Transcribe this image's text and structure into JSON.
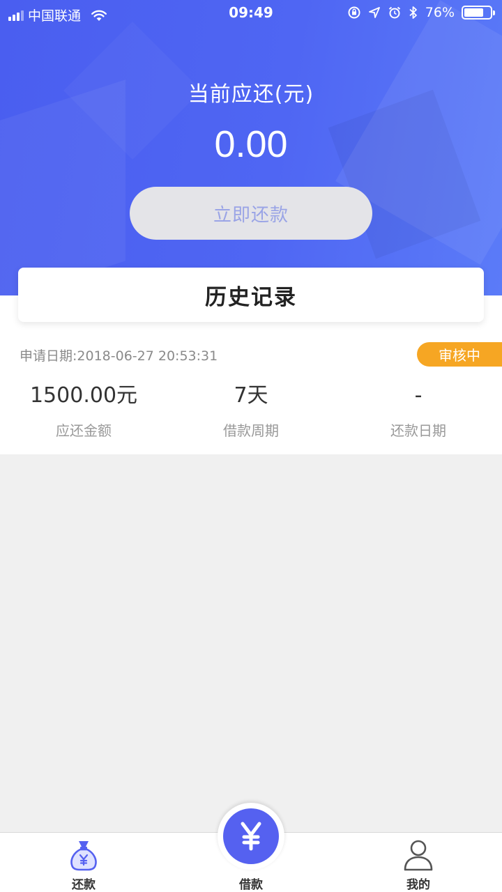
{
  "status_bar": {
    "carrier": "中国联通",
    "time": "09:49",
    "battery": "76%",
    "battery_level": 0.76
  },
  "hero": {
    "amount_label": "当前应还(元)",
    "amount": "0.00",
    "repay_button": "立即还款"
  },
  "history": {
    "title": "历史记录",
    "records": [
      {
        "apply_date": "申请日期:2018-06-27 20:53:31",
        "status": "审核中",
        "amount_value": "1500.00元",
        "amount_label": "应还金额",
        "period_value": "7天",
        "period_label": "借款周期",
        "repay_date_value": "-",
        "repay_date_label": "还款日期"
      }
    ]
  },
  "tabbar": {
    "tabs": [
      {
        "label": "还款",
        "icon": "money-bag-icon"
      },
      {
        "label": "借款",
        "icon": "yen-icon"
      },
      {
        "label": "我的",
        "icon": "user-icon"
      }
    ]
  },
  "colors": {
    "primary": "#4f66f3",
    "badge": "#f6a623",
    "button_bg": "#e4e4e8",
    "button_text": "#9aa4e6"
  }
}
